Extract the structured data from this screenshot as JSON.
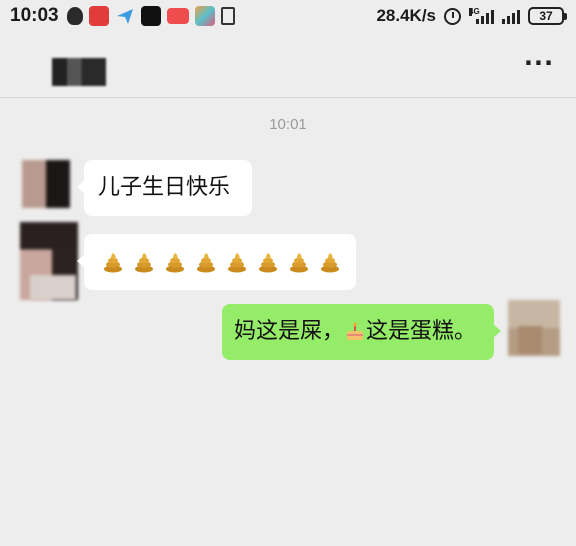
{
  "status_bar": {
    "time": "10:03",
    "net_speed": "28.4K/s",
    "network_label": "4G",
    "battery": "37"
  },
  "header": {
    "contact_name": "",
    "more_label": "···"
  },
  "chat": {
    "timestamp": "10:01",
    "messages": [
      {
        "sender": "contact",
        "text": "儿子生日快乐"
      },
      {
        "sender": "contact",
        "emoji": "poop-icon",
        "count": 8
      },
      {
        "sender": "me",
        "text_before": "妈这是屎，",
        "emoji": "cake-icon",
        "text_after": "这是蛋糕。"
      }
    ]
  },
  "colors": {
    "background": "#ededed",
    "incoming_bubble": "#ffffff",
    "outgoing_bubble": "#95ec69",
    "timestamp": "#9a9a9a"
  }
}
